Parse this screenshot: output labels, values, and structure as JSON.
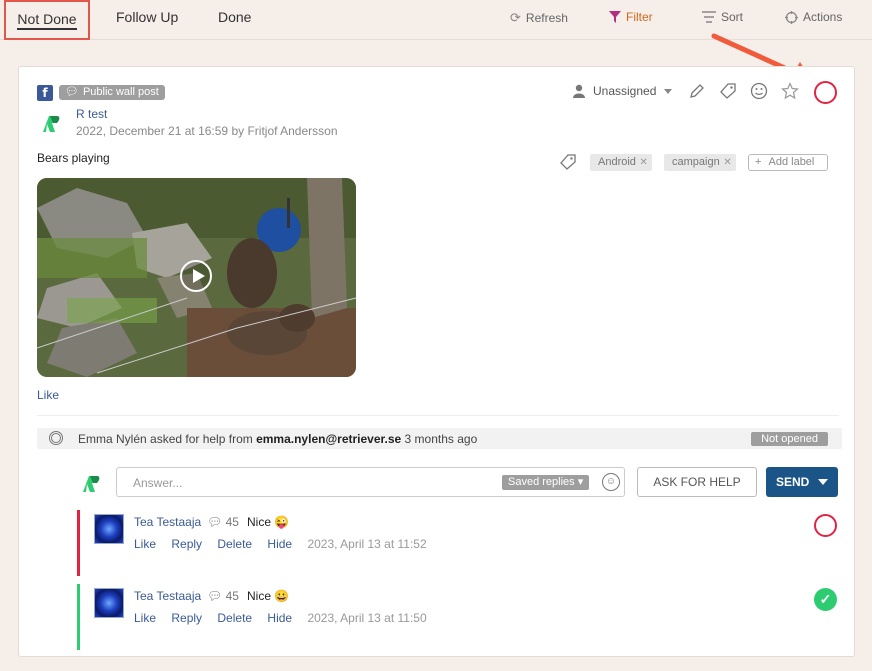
{
  "tabs": {
    "not_done": "Not Done",
    "follow_up": "Follow Up",
    "done": "Done"
  },
  "toolbar": {
    "refresh": "Refresh",
    "filter": "Filter",
    "sort": "Sort",
    "actions": "Actions"
  },
  "post": {
    "network_icon": "facebook-icon",
    "type_badge": "Public wall post",
    "assignee": "Unassigned",
    "author": "R test",
    "timestamp": "2022, December 21 at 16:59 by Fritjof Andersson",
    "text": "Bears playing",
    "labels": [
      "Android",
      "campaign"
    ],
    "add_label": "Add label",
    "like": "Like"
  },
  "help": {
    "requester": "Emma Nylén asked for help from",
    "email": "emma.nylen@retriever.se",
    "when": "3 months ago",
    "status": "Not opened"
  },
  "reply": {
    "placeholder": "Answer...",
    "saved_replies": "Saved replies",
    "ask_for_help": "ASK FOR HELP",
    "send": "SEND"
  },
  "comments": [
    {
      "author": "Tea Testaaja",
      "count": "45",
      "text": "Nice 😜",
      "like": "Like",
      "reply": "Reply",
      "delete": "Delete",
      "hide": "Hide",
      "time": "2023, April 13 at 11:52",
      "bar_color": "#e02444",
      "status": "not-done"
    },
    {
      "author": "Tea Testaaja",
      "count": "45",
      "text": "Nice 😀",
      "like": "Like",
      "reply": "Reply",
      "delete": "Delete",
      "hide": "Hide",
      "time": "2023, April 13 at 11:50",
      "bar_color": "#2ecc71",
      "status": "done"
    }
  ],
  "colors": {
    "accent_red": "#e02444",
    "send_blue": "#1b5487",
    "link_blue": "#3a5a97",
    "done_green": "#2ecc71"
  }
}
